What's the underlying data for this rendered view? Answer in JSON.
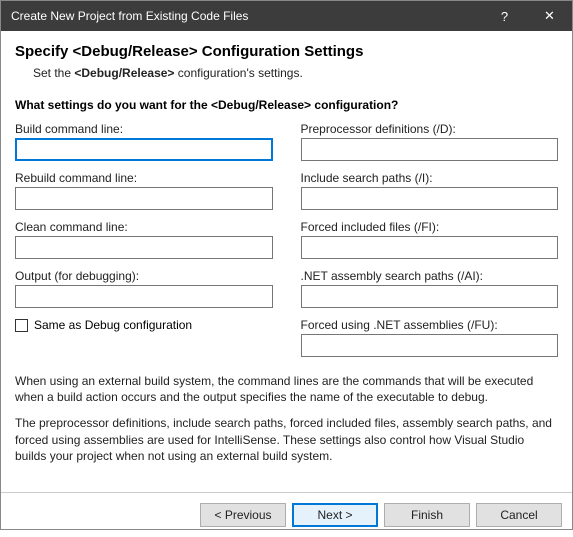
{
  "titlebar": {
    "title": "Create New Project from Existing Code Files",
    "help": "?",
    "close": "✕"
  },
  "heading": "Specify  <Debug/Release>  Configuration Settings",
  "subheading_prefix": "Set the ",
  "subheading_mid": "<Debug/Release>",
  "subheading_suffix": " configuration's settings.",
  "question_prefix": "What settings do you want for the ",
  "question_mid": "<Debug/Release>",
  "question_suffix": " configuration?",
  "fields": {
    "build": {
      "label": "Build command line:",
      "value": ""
    },
    "rebuild": {
      "label": "Rebuild command line:",
      "value": ""
    },
    "clean": {
      "label": "Clean command line:",
      "value": ""
    },
    "output": {
      "label": "Output (for debugging):",
      "value": ""
    },
    "preproc": {
      "label": "Preprocessor definitions (/D):",
      "value": ""
    },
    "include": {
      "label": "Include search paths (/I):",
      "value": ""
    },
    "forcedinc": {
      "label": "Forced included files (/FI):",
      "value": ""
    },
    "netasm": {
      "label": ".NET assembly search paths (/AI):",
      "value": ""
    },
    "forcedusing": {
      "label": "Forced using .NET assemblies (/FU):",
      "value": ""
    }
  },
  "checkbox": {
    "label": "Same as Debug configuration",
    "checked": false
  },
  "desc1": "When using an external build system, the command lines are the commands that will be executed when a build action occurs and the output specifies the name of the executable to debug.",
  "desc2": "The preprocessor definitions, include search paths, forced included files, assembly search paths, and forced using assemblies are used for IntelliSense.  These settings also control how Visual Studio builds your project when not using an external build system.",
  "buttons": {
    "previous": "< Previous",
    "next": "Next >",
    "finish": "Finish",
    "cancel": "Cancel"
  }
}
